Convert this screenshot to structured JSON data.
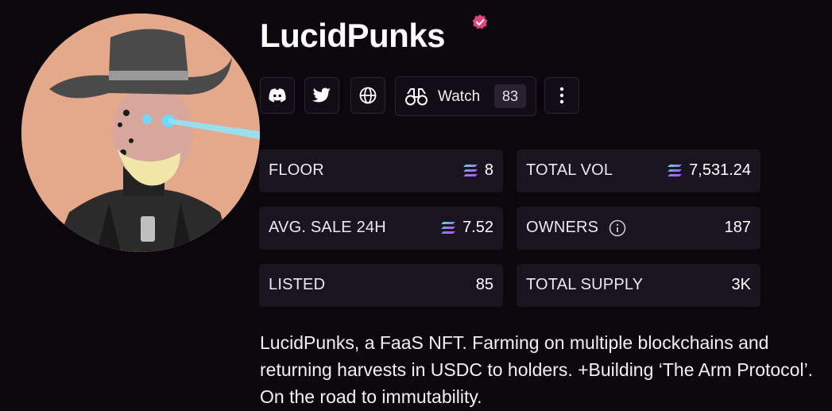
{
  "collection": {
    "name": "LucidPunks",
    "verified_icon": "verified-badge-icon",
    "accent": "#e0457b"
  },
  "actions": {
    "discord_icon": "discord-icon",
    "twitter_icon": "twitter-icon",
    "website_icon": "globe-icon",
    "watch_label": "Watch",
    "watch_count": "83",
    "more_icon": "more-vertical-icon"
  },
  "stats": [
    {
      "label": "FLOOR",
      "value": "8",
      "currency_icon": "solana-icon"
    },
    {
      "label": "TOTAL VOL",
      "value": "7,531.24",
      "currency_icon": "solana-icon"
    },
    {
      "label": "AVG. SALE 24H",
      "value": "7.52",
      "currency_icon": "solana-icon"
    },
    {
      "label": "OWNERS",
      "value": "187",
      "info_icon": "info-icon"
    },
    {
      "label": "LISTED",
      "value": "85"
    },
    {
      "label": "TOTAL SUPPLY",
      "value": "3K"
    }
  ],
  "description": "LucidPunks, a FaaS NFT. Farming on multiple blockchains and returning harvests in USDC to holders. +Building ‘The Arm Protocol’. On the road to immutability."
}
